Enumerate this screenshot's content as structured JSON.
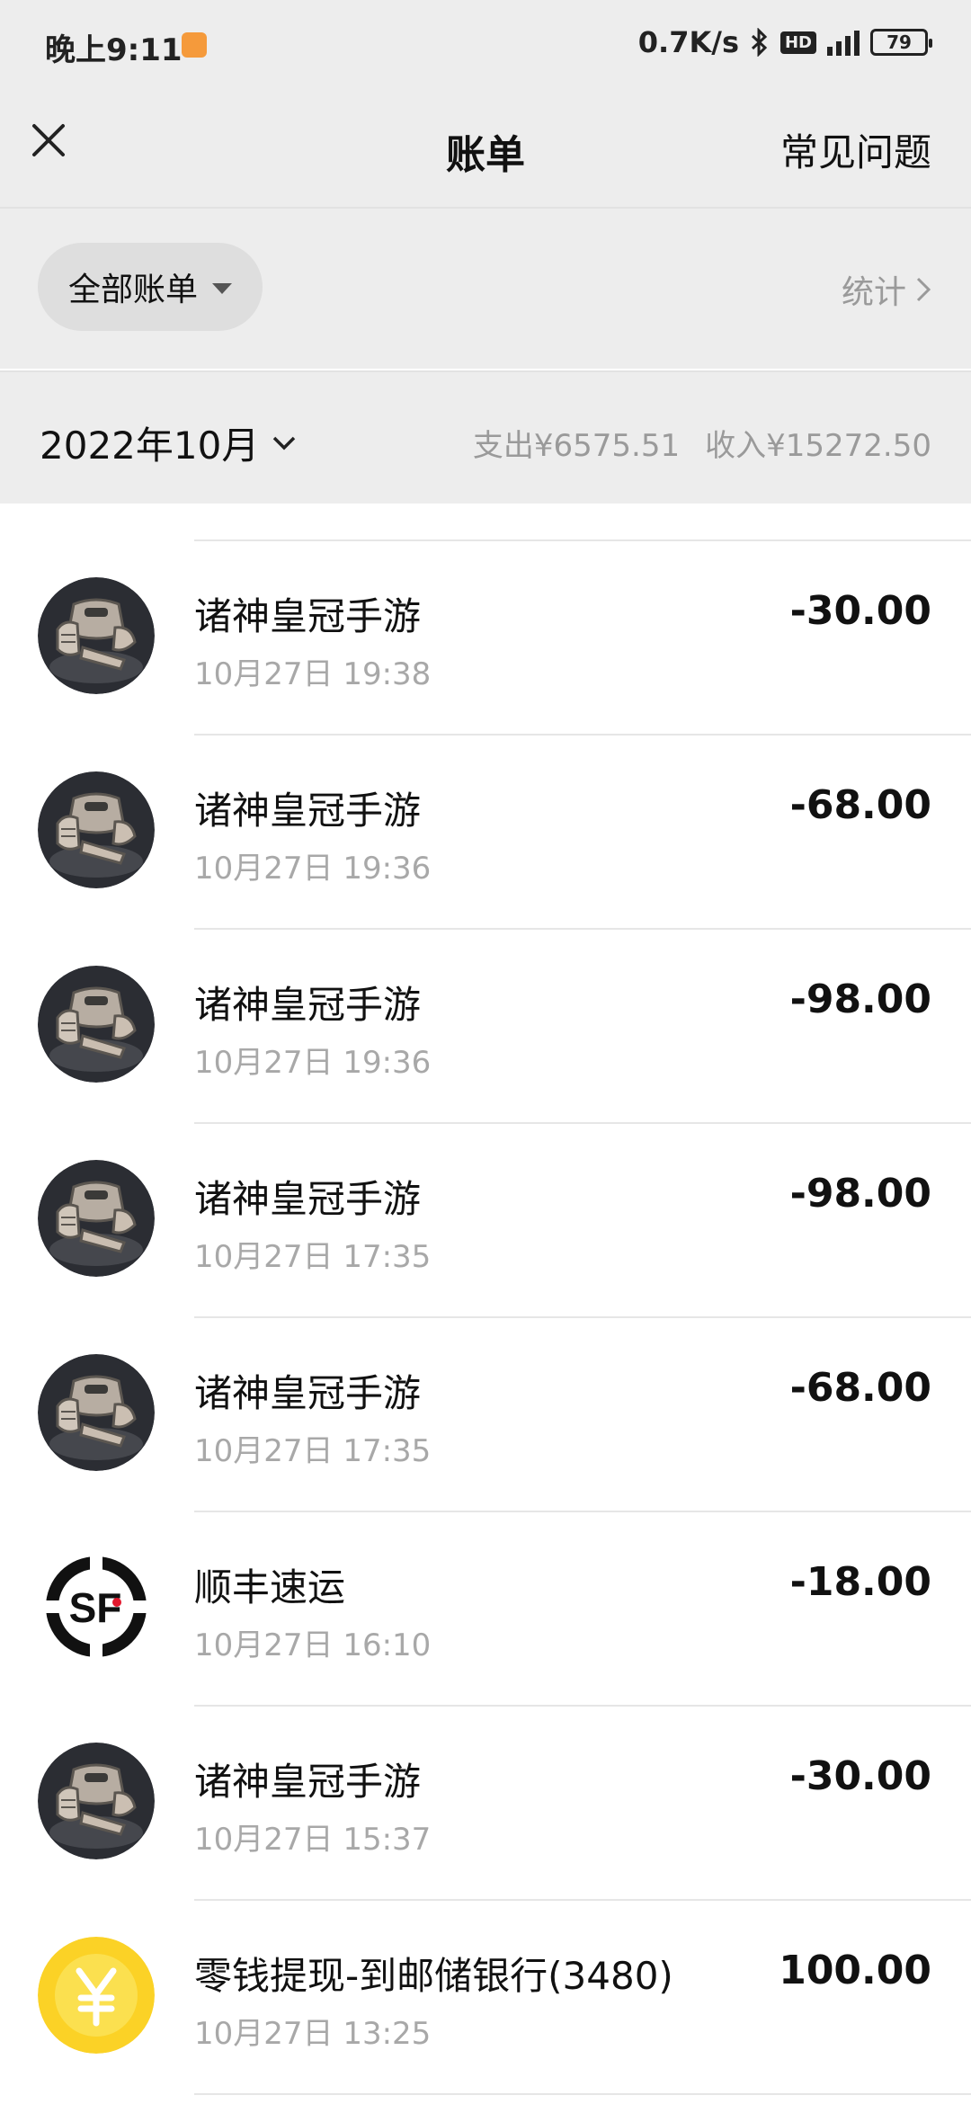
{
  "status_bar": {
    "time": "晚上9:11",
    "speed": "0.7K/s",
    "hd": "HD",
    "network": "4G",
    "battery": "79"
  },
  "nav": {
    "title": "账单",
    "faq": "常见问题"
  },
  "filter": {
    "label": "全部账单",
    "stats": "统计"
  },
  "month": {
    "label": "2022年10月",
    "expense": "支出¥6575.51",
    "income": "收入¥15272.50"
  },
  "bills": [
    {
      "name": "诸神皇冠手游",
      "time": "10月27日 19:38",
      "amount": "-30.00",
      "icon": "armor-game-icon"
    },
    {
      "name": "诸神皇冠手游",
      "time": "10月27日 19:36",
      "amount": "-68.00",
      "icon": "armor-game-icon"
    },
    {
      "name": "诸神皇冠手游",
      "time": "10月27日 19:36",
      "amount": "-98.00",
      "icon": "armor-game-icon"
    },
    {
      "name": "诸神皇冠手游",
      "time": "10月27日 17:35",
      "amount": "-98.00",
      "icon": "armor-game-icon"
    },
    {
      "name": "诸神皇冠手游",
      "time": "10月27日 17:35",
      "amount": "-68.00",
      "icon": "armor-game-icon"
    },
    {
      "name": "顺丰速运",
      "time": "10月27日 16:10",
      "amount": "-18.00",
      "icon": "sf-express-icon"
    },
    {
      "name": "诸神皇冠手游",
      "time": "10月27日 15:37",
      "amount": "-30.00",
      "icon": "armor-game-icon"
    },
    {
      "name": "零钱提现-到邮储银行(3480)",
      "time": "10月27日 13:25",
      "amount": "100.00",
      "icon": "yuan-coin-icon"
    }
  ]
}
